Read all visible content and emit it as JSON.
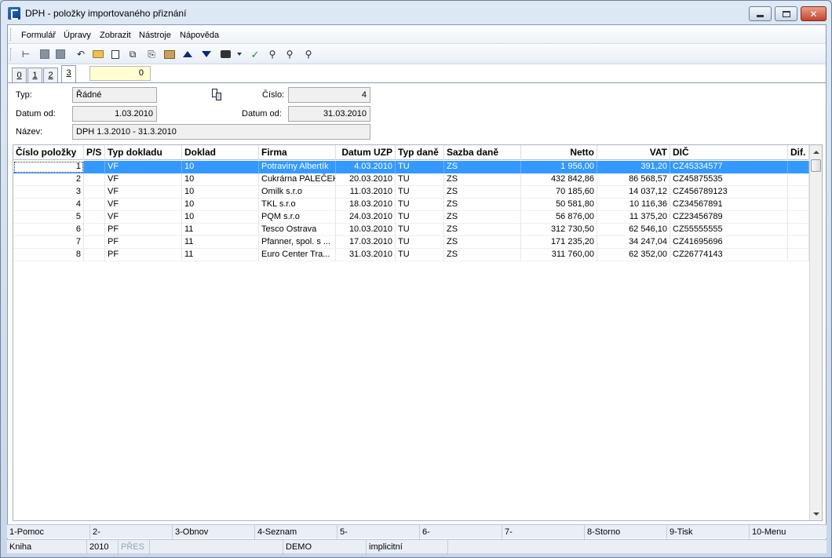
{
  "window": {
    "title": "DPH - položky importovaného přiznání",
    "close_glyph": "✕"
  },
  "menu": [
    {
      "label": "Formulář"
    },
    {
      "label": "Úpravy"
    },
    {
      "label": "Zobrazit"
    },
    {
      "label": "Nástroje"
    },
    {
      "label": "Nápověda"
    }
  ],
  "toolbar": {
    "icons": [
      "tree-icon",
      "save-icon",
      "save-as-icon",
      "undo-icon",
      "open-folder-icon",
      "new-document-icon",
      "copy-icon",
      "paste-icon",
      "book-icon",
      "arrow-up-icon",
      "arrow-down-icon",
      "camera-icon",
      "dropdown-arrow-icon",
      "check-icon",
      "binoculars-icon",
      "find-next-icon",
      "find-replace-icon"
    ]
  },
  "tabs": [
    {
      "label": "0"
    },
    {
      "label": "1"
    },
    {
      "label": "2"
    },
    {
      "label": "3"
    }
  ],
  "tab_field_value": "0",
  "form": {
    "typ_label": "Typ:",
    "typ_value": "Řádné",
    "cislo_label": "Číslo:",
    "cislo_value": "4",
    "datum_od_label": "Datum od:",
    "datum_od_value": "1.03.2010",
    "datum_do_label": "Datum od:",
    "datum_do_value": "31.03.2010",
    "nazev_label": "Název:",
    "nazev_value": "DPH 1.3.2010 - 31.3.2010"
  },
  "table": {
    "columns": [
      "Číslo položky",
      "P/S",
      "Typ dokladu",
      "Doklad",
      "Firma",
      "Datum UZP",
      "Typ daně",
      "Sazba daně",
      "Netto",
      "VAT",
      "DIČ",
      "Dif."
    ],
    "rows": [
      [
        "1",
        "",
        "VF",
        "10",
        "Potraviny Albertík",
        "4.03.2010",
        "TU",
        "ZS",
        "1 956,00",
        "391,20",
        "CZ45334577",
        ""
      ],
      [
        "2",
        "",
        "VF",
        "10",
        "Cukrárna PALEČEK",
        "20.03.2010",
        "TU",
        "ZS",
        "432 842,86",
        "86 568,57",
        "CZ45875535",
        ""
      ],
      [
        "3",
        "",
        "VF",
        "10",
        "Omilk s.r.o",
        "11.03.2010",
        "TU",
        "ZS",
        "70 185,60",
        "14 037,12",
        "CZ456789123",
        ""
      ],
      [
        "4",
        "",
        "VF",
        "10",
        "TKL s.r.o",
        "18.03.2010",
        "TU",
        "ZS",
        "50 581,80",
        "10 116,36",
        "CZ34567891",
        ""
      ],
      [
        "5",
        "",
        "VF",
        "10",
        "PQM s.r.o",
        "24.03.2010",
        "TU",
        "ZS",
        "56 876,00",
        "11 375,20",
        "CZ23456789",
        ""
      ],
      [
        "6",
        "",
        "PF",
        "11",
        "Tesco Ostrava",
        "10.03.2010",
        "TU",
        "ZS",
        "312 730,50",
        "62 546,10",
        "CZ55555555",
        ""
      ],
      [
        "7",
        "",
        "PF",
        "11",
        "Pfanner, spol. s ...",
        "17.03.2010",
        "TU",
        "ZS",
        "171 235,20",
        "34 247,04",
        "CZ41695696",
        ""
      ],
      [
        "8",
        "",
        "PF",
        "11",
        "Euro Center Tra...",
        "31.03.2010",
        "TU",
        "ZS",
        "311 760,00",
        "62 352,00",
        "CZ26774143",
        ""
      ]
    ]
  },
  "fkeys": [
    "1-Pomoc",
    "2-",
    "3-Obnov",
    "4-Seznam",
    "5-",
    "6-",
    "7-",
    "8-Storno",
    "9-Tisk",
    "10-Menu"
  ],
  "status": [
    "Kniha",
    "2010",
    "PŘES",
    "",
    "DEMO",
    "implicitní"
  ],
  "colors": {
    "selection": "#3399ff",
    "tab_field_bg": "#ffffd2"
  }
}
